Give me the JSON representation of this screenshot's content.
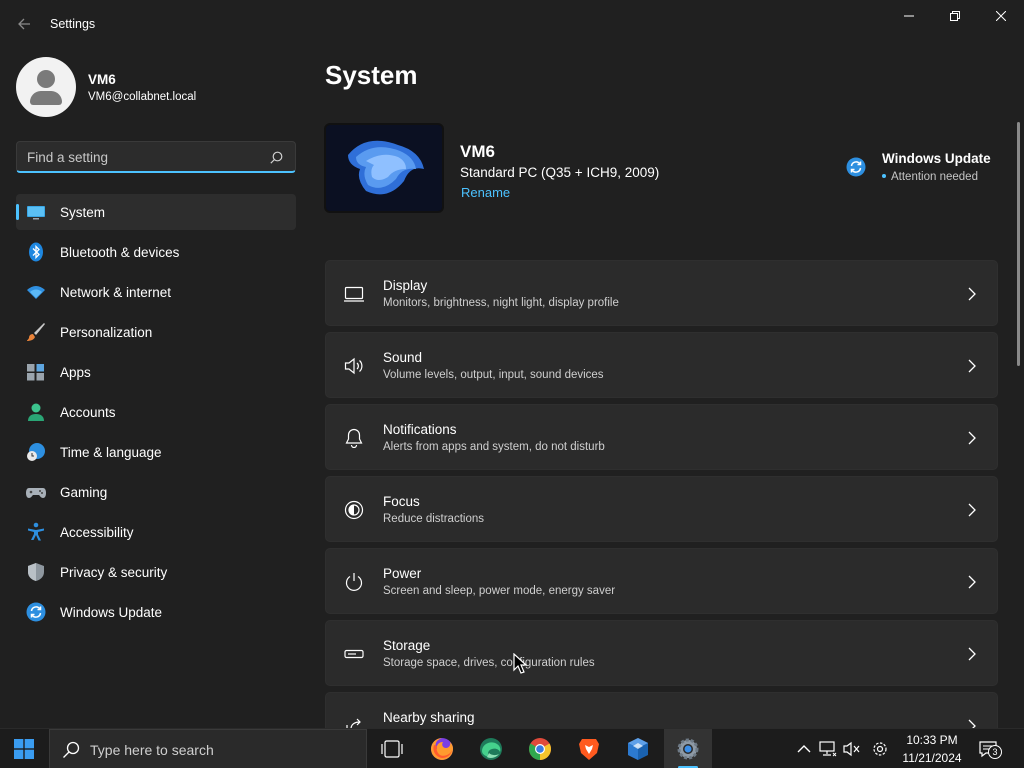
{
  "window": {
    "title": "Settings"
  },
  "profile": {
    "name": "VM6",
    "email": "VM6@collabnet.local"
  },
  "search": {
    "placeholder": "Find a setting"
  },
  "sidebar": {
    "items": [
      {
        "label": "System",
        "icon": "system-icon",
        "active": true
      },
      {
        "label": "Bluetooth & devices",
        "icon": "bluetooth-icon"
      },
      {
        "label": "Network & internet",
        "icon": "wifi-icon"
      },
      {
        "label": "Personalization",
        "icon": "brush-icon"
      },
      {
        "label": "Apps",
        "icon": "apps-icon"
      },
      {
        "label": "Accounts",
        "icon": "accounts-icon"
      },
      {
        "label": "Time & language",
        "icon": "time-language-icon"
      },
      {
        "label": "Gaming",
        "icon": "gaming-icon"
      },
      {
        "label": "Accessibility",
        "icon": "accessibility-icon"
      },
      {
        "label": "Privacy & security",
        "icon": "shield-icon"
      },
      {
        "label": "Windows Update",
        "icon": "windows-update-icon"
      }
    ]
  },
  "main": {
    "title": "System",
    "device": {
      "name": "VM6",
      "model": "Standard PC (Q35 + ICH9, 2009)",
      "rename_label": "Rename"
    },
    "windows_update": {
      "title": "Windows Update",
      "status": "Attention needed"
    },
    "cards": [
      {
        "title": "Display",
        "desc": "Monitors, brightness, night light, display profile",
        "icon": "display-icon"
      },
      {
        "title": "Sound",
        "desc": "Volume levels, output, input, sound devices",
        "icon": "speaker-icon"
      },
      {
        "title": "Notifications",
        "desc": "Alerts from apps and system, do not disturb",
        "icon": "bell-icon"
      },
      {
        "title": "Focus",
        "desc": "Reduce distractions",
        "icon": "focus-icon"
      },
      {
        "title": "Power",
        "desc": "Screen and sleep, power mode, energy saver",
        "icon": "power-icon"
      },
      {
        "title": "Storage",
        "desc": "Storage space, drives, configuration rules",
        "icon": "storage-icon"
      },
      {
        "title": "Nearby sharing",
        "desc": "",
        "icon": "share-icon"
      }
    ]
  },
  "taskbar": {
    "search_placeholder": "Type here to search",
    "time": "10:33 PM",
    "date": "11/21/2024",
    "notification_count": "3"
  },
  "colors": {
    "accent": "#4cc2ff",
    "background": "#202020",
    "card": "#2b2b2b"
  }
}
